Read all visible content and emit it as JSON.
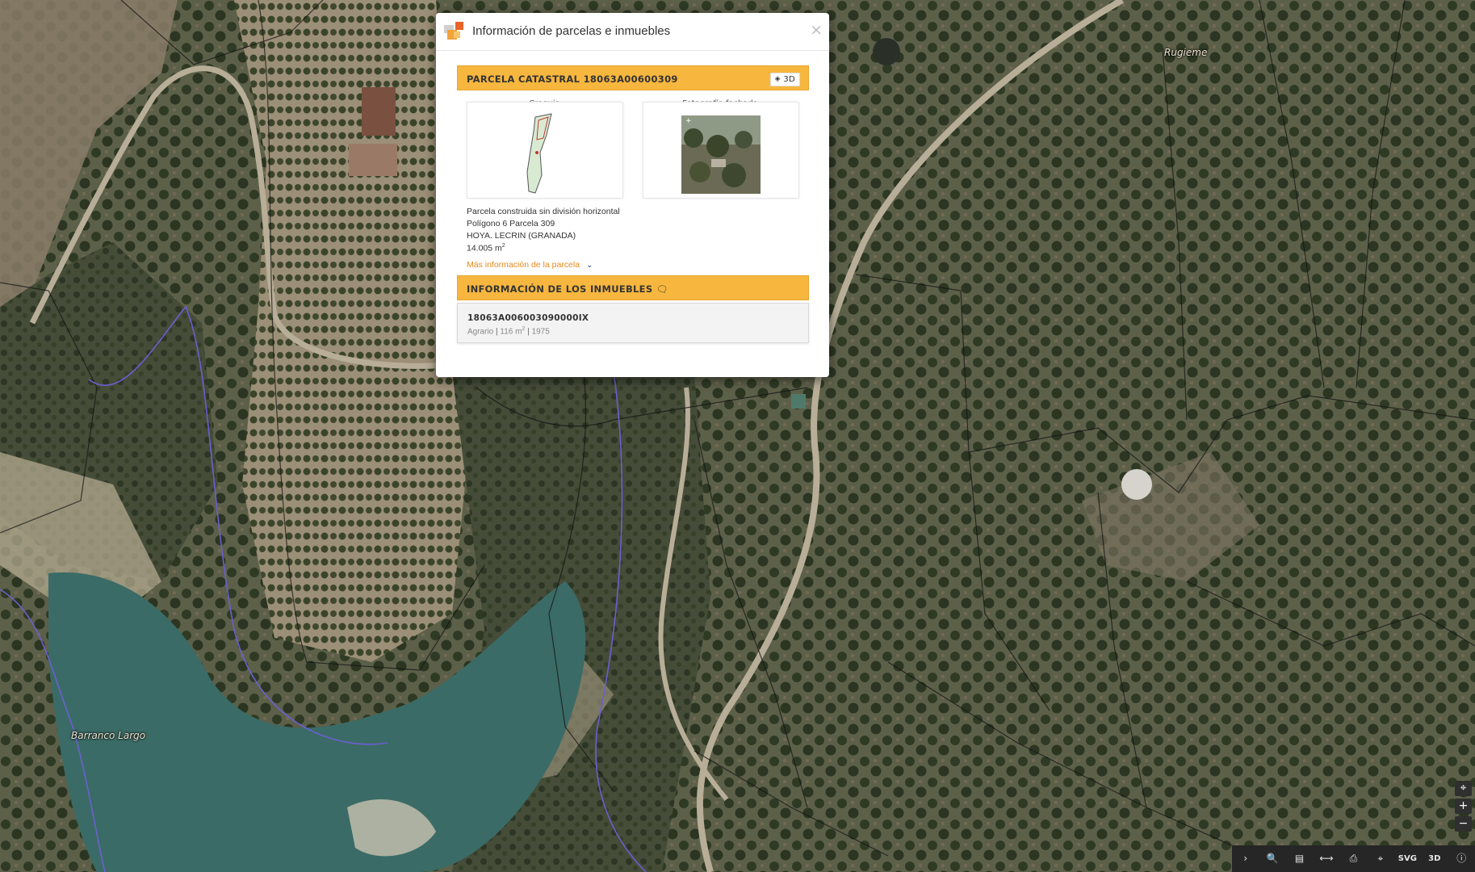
{
  "dialog": {
    "title": "Información de parcelas e inmuebles",
    "close_glyph": "×",
    "parcel_section": {
      "title": "PARCELA CATASTRAL 18063A00600309",
      "btn_3d_label": "3D"
    },
    "sketch_label": "Croquis",
    "photo_label": "Fotografía fachada",
    "parcel_info": {
      "line1": "Parcela construida sin división horizontal",
      "line2": "Polígono 6 Parcela 309",
      "line3": "HOYA. LECRIN (GRANADA)",
      "area_value": "14.005 m",
      "area_sup": "2"
    },
    "more_info_link": "Más información de la parcela",
    "properties_section": {
      "title": "INFORMACIÓN DE LOS INMUEBLES"
    },
    "property": {
      "reference": "18063A006003090000IX",
      "use": "Agrario",
      "sep": "|",
      "area": "116 m",
      "area_sup": "2",
      "year": "1975"
    }
  },
  "map": {
    "labels": {
      "north": "Rugieme",
      "river": "Barranco Largo"
    },
    "zoom_controls": {
      "locate": "⌖",
      "zoom_in": "+",
      "zoom_out": "−"
    },
    "toolbar": {
      "expand": "›",
      "search": "🔍",
      "layers": "▤",
      "measure": "⟷",
      "print": "⎙",
      "coordinates": "⌖",
      "svg_label": "SVG",
      "view3d": "3D",
      "info": "ⓘ"
    }
  },
  "colors": {
    "accent_orange": "#f7b73e",
    "link_orange": "#e58a1e",
    "map_water": "#3b6b66",
    "map_vegetation": "#3c4430"
  }
}
